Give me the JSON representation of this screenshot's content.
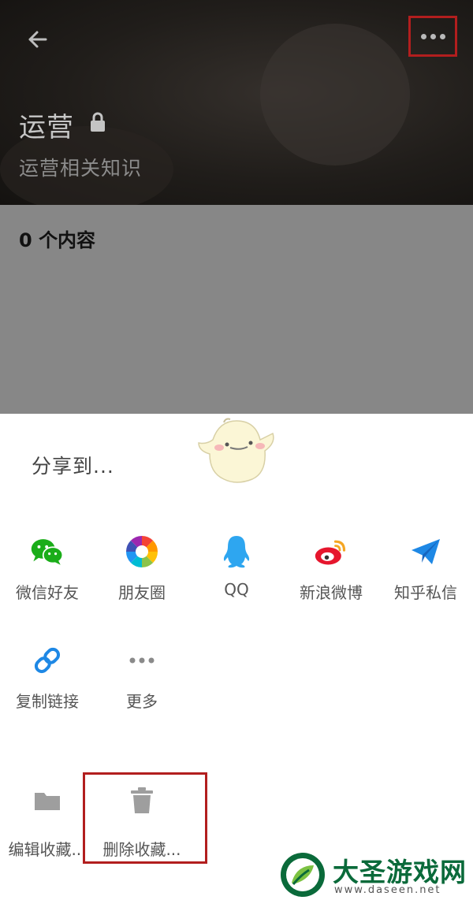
{
  "header": {
    "title": "运营",
    "subtitle": "运营相关知识",
    "back_icon": "arrow-left-icon",
    "more_icon": "more-horizontal-icon",
    "lock_icon": "lock-icon"
  },
  "content": {
    "count_number": "0",
    "count_unit": "个内容"
  },
  "share_sheet": {
    "title": "分享到...",
    "share_targets": [
      {
        "label": "微信好友",
        "icon": "wechat-icon",
        "color": "#1aad19"
      },
      {
        "label": "朋友圈",
        "icon": "moments-icon",
        "color": "#f5a623"
      },
      {
        "label": "QQ",
        "icon": "qq-icon",
        "color": "#2ea6f0"
      },
      {
        "label": "新浪微博",
        "icon": "weibo-icon",
        "color": "#e6162d"
      },
      {
        "label": "知乎私信",
        "icon": "paper-plane-icon",
        "color": "#1e88e5"
      }
    ],
    "more_targets": [
      {
        "label": "复制链接",
        "icon": "link-icon",
        "color": "#1e88e5"
      },
      {
        "label": "更多",
        "icon": "more-dots-icon",
        "color": "#8a8a8a"
      }
    ],
    "actions": [
      {
        "label": "编辑收藏...",
        "icon": "folder-icon"
      },
      {
        "label": "删除收藏...",
        "icon": "trash-icon"
      }
    ]
  },
  "watermark": {
    "name": "大圣游戏网",
    "url": "www.daseen.net"
  },
  "colors": {
    "highlight_border": "#b21e1e",
    "watermark_green": "#0a6a3a"
  }
}
